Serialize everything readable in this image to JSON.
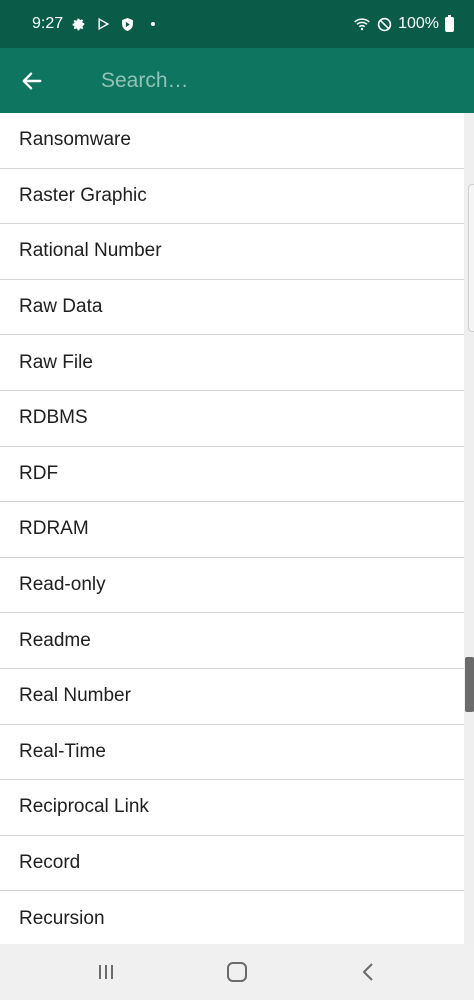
{
  "status_bar": {
    "time": "9:27",
    "battery_percent": "100%",
    "icons": [
      "gear-icon",
      "play-store-icon",
      "shield-icon",
      "dot-icon",
      "wifi-icon",
      "do-not-disturb-icon",
      "battery-icon"
    ]
  },
  "app_bar": {
    "back_icon": "arrow-left-icon",
    "search_placeholder": "Search…"
  },
  "list": {
    "items": [
      {
        "label": "Ransomware"
      },
      {
        "label": "Raster Graphic"
      },
      {
        "label": "Rational Number"
      },
      {
        "label": "Raw Data"
      },
      {
        "label": "Raw File"
      },
      {
        "label": "RDBMS"
      },
      {
        "label": "RDF"
      },
      {
        "label": "RDRAM"
      },
      {
        "label": "Read-only"
      },
      {
        "label": "Readme"
      },
      {
        "label": "Real Number"
      },
      {
        "label": "Real-Time"
      },
      {
        "label": "Reciprocal Link"
      },
      {
        "label": "Record"
      },
      {
        "label": "Recursion"
      }
    ]
  },
  "nav_bar": {
    "icons": [
      "recent-apps-icon",
      "home-icon",
      "back-icon"
    ]
  },
  "colors": {
    "status_bar": "#0a5c49",
    "app_bar": "#0e7660",
    "placeholder": "#8fc3b5"
  }
}
